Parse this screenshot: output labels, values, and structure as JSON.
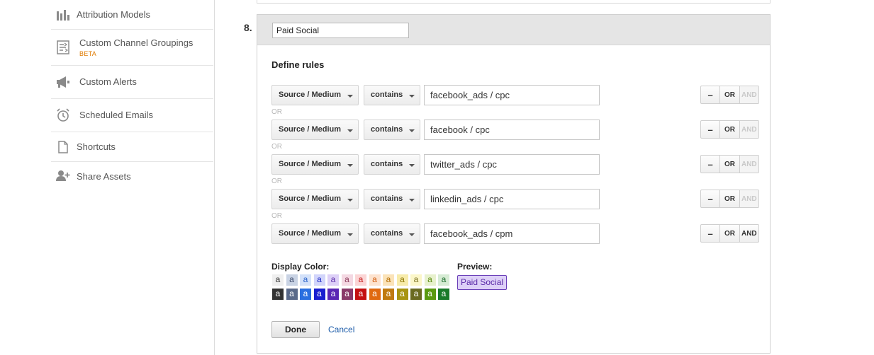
{
  "sidebar": {
    "items": [
      {
        "label": "Attribution Models",
        "icon": "bar-chart-icon"
      },
      {
        "label": "Custom Channel Groupings",
        "badge": "BETA",
        "icon": "channel-grouping-icon"
      },
      {
        "label": "Custom Alerts",
        "icon": "megaphone-icon"
      },
      {
        "label": "Scheduled Emails",
        "icon": "alarm-clock-icon"
      },
      {
        "label": "Shortcuts",
        "icon": "document-icon"
      },
      {
        "label": "Share Assets",
        "icon": "add-user-icon"
      }
    ]
  },
  "group": {
    "step_number": "8.",
    "name": "Paid Social",
    "define_rules_label": "Define rules",
    "separator_label": "OR",
    "rules": [
      {
        "dimension": "Source / Medium",
        "operator": "contains",
        "value": "facebook_ads / cpc",
        "btn_minus": "–",
        "btn_or": "OR",
        "btn_and": "AND",
        "and_enabled": false
      },
      {
        "dimension": "Source / Medium",
        "operator": "contains",
        "value": "facebook / cpc",
        "btn_minus": "–",
        "btn_or": "OR",
        "btn_and": "AND",
        "and_enabled": false
      },
      {
        "dimension": "Source / Medium",
        "operator": "contains",
        "value": "twitter_ads / cpc",
        "btn_minus": "–",
        "btn_or": "OR",
        "btn_and": "AND",
        "and_enabled": false
      },
      {
        "dimension": "Source / Medium",
        "operator": "contains",
        "value": "linkedin_ads / cpc",
        "btn_minus": "–",
        "btn_or": "OR",
        "btn_and": "AND",
        "and_enabled": false
      },
      {
        "dimension": "Source / Medium",
        "operator": "contains",
        "value": "facebook_ads / cpm",
        "btn_minus": "–",
        "btn_or": "OR",
        "btn_and": "AND",
        "and_enabled": true
      }
    ],
    "display_color_label": "Display Color:",
    "swatch_letter": "a",
    "light_swatches": [
      {
        "bg": "#efefef",
        "fg": "#333333"
      },
      {
        "bg": "#c9d3e4",
        "fg": "#3b4a6b"
      },
      {
        "bg": "#d3e1f9",
        "fg": "#2a62c9"
      },
      {
        "bg": "#d2d5fb",
        "fg": "#1a27c4"
      },
      {
        "bg": "#ddd0f7",
        "fg": "#5a2aa8"
      },
      {
        "bg": "#f4d8e2",
        "fg": "#8a3a5a"
      },
      {
        "bg": "#fbd5d5",
        "fg": "#c41a1a"
      },
      {
        "bg": "#fde3cf",
        "fg": "#d25a0a"
      },
      {
        "bg": "#fbe3b8",
        "fg": "#b26a00"
      },
      {
        "bg": "#f7ebaa",
        "fg": "#8a7200"
      },
      {
        "bg": "#fbf6c8",
        "fg": "#7a7020"
      },
      {
        "bg": "#e7f1cd",
        "fg": "#5a8a10"
      },
      {
        "bg": "#d6ebd4",
        "fg": "#1a6a2a"
      }
    ],
    "dark_swatches": [
      {
        "bg": "#333333",
        "fg": "#ffffff"
      },
      {
        "bg": "#5a6a8a",
        "fg": "#ffffff"
      },
      {
        "bg": "#2a6fe0",
        "fg": "#ffffff"
      },
      {
        "bg": "#1a1fd0",
        "fg": "#ffffff"
      },
      {
        "bg": "#5a26b4",
        "fg": "#ffffff"
      },
      {
        "bg": "#8a3a6a",
        "fg": "#ffffff"
      },
      {
        "bg": "#c41010",
        "fg": "#ffffff"
      },
      {
        "bg": "#e06a10",
        "fg": "#ffffff"
      },
      {
        "bg": "#c07a10",
        "fg": "#ffffff"
      },
      {
        "bg": "#a89410",
        "fg": "#ffffff"
      },
      {
        "bg": "#6a6a20",
        "fg": "#ffffff"
      },
      {
        "bg": "#5a9a10",
        "fg": "#ffffff"
      },
      {
        "bg": "#1a7a2a",
        "fg": "#ffffff"
      }
    ],
    "preview_label": "Preview:",
    "preview_colors": {
      "bg": "#ddd0f7",
      "fg": "#5a2aa8",
      "border": "#6a3fb8"
    },
    "done_label": "Done",
    "cancel_label": "Cancel"
  }
}
